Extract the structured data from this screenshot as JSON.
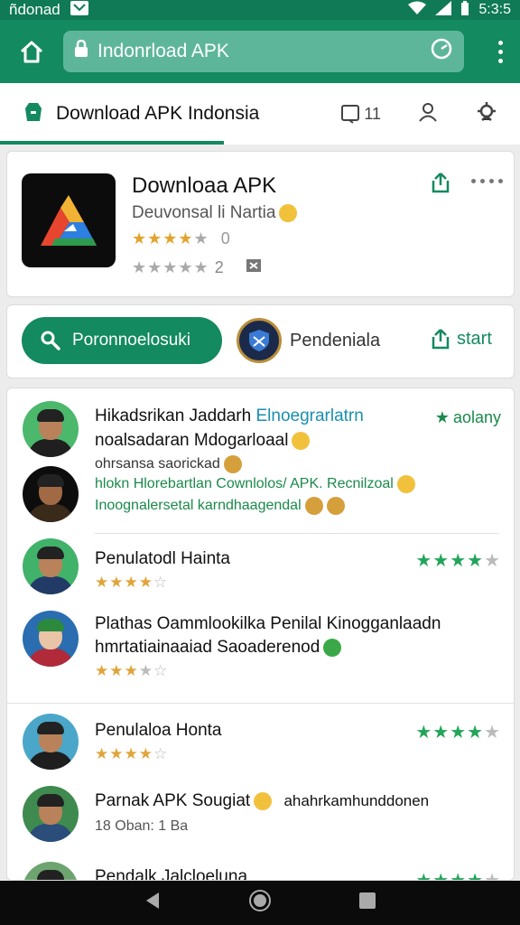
{
  "status_bar": {
    "carrier": "ñdonad",
    "time": "5:3:5"
  },
  "browser": {
    "url": "Indonrload APK"
  },
  "title_bar": {
    "title": "Download APK Indonsia",
    "notifications_count": "11"
  },
  "app": {
    "name": "Downloaa APK",
    "subtitle": "Deuvonsal li Nartia",
    "rating_stars": 4,
    "rating_value": "0",
    "rating2_value": "2"
  },
  "actions": {
    "primary_label": "Poronnoelosuki",
    "secondary_label": "Pendeniala",
    "start_label": "start"
  },
  "reviews": [
    {
      "line1": "Hikadsrikan Jaddarh",
      "line1_accent": "Elnoegrarlatrn",
      "badge": "aolany",
      "line2": "noalsadaran Mdogarloaal",
      "line3": "ohrsansa saorickad",
      "line4": "hlokn Hlorebartlan Cownlolos/ APK. Recnilzoal",
      "line5": "Inoognalersetal karndhaagendal"
    },
    {
      "name": "Penulatodl Hainta",
      "green_stars": 4,
      "gold_stars": 3.5
    },
    {
      "line1": "Plathas Oammlookilka Penilal Kinogganlaadn",
      "line2": "hmrtatiainaaiad Saoaderenod",
      "gold_stars": 3
    },
    {
      "name": "Penulaloa Honta",
      "green_stars": 4,
      "gold_stars": 3.5
    },
    {
      "line1": "Parnak APK Sougiat",
      "line1_right": "ahahrkamhunddonen",
      "line2": "18 Oban: 1 Ba"
    },
    {
      "name": "Pendalk Jalcloeluna"
    }
  ]
}
